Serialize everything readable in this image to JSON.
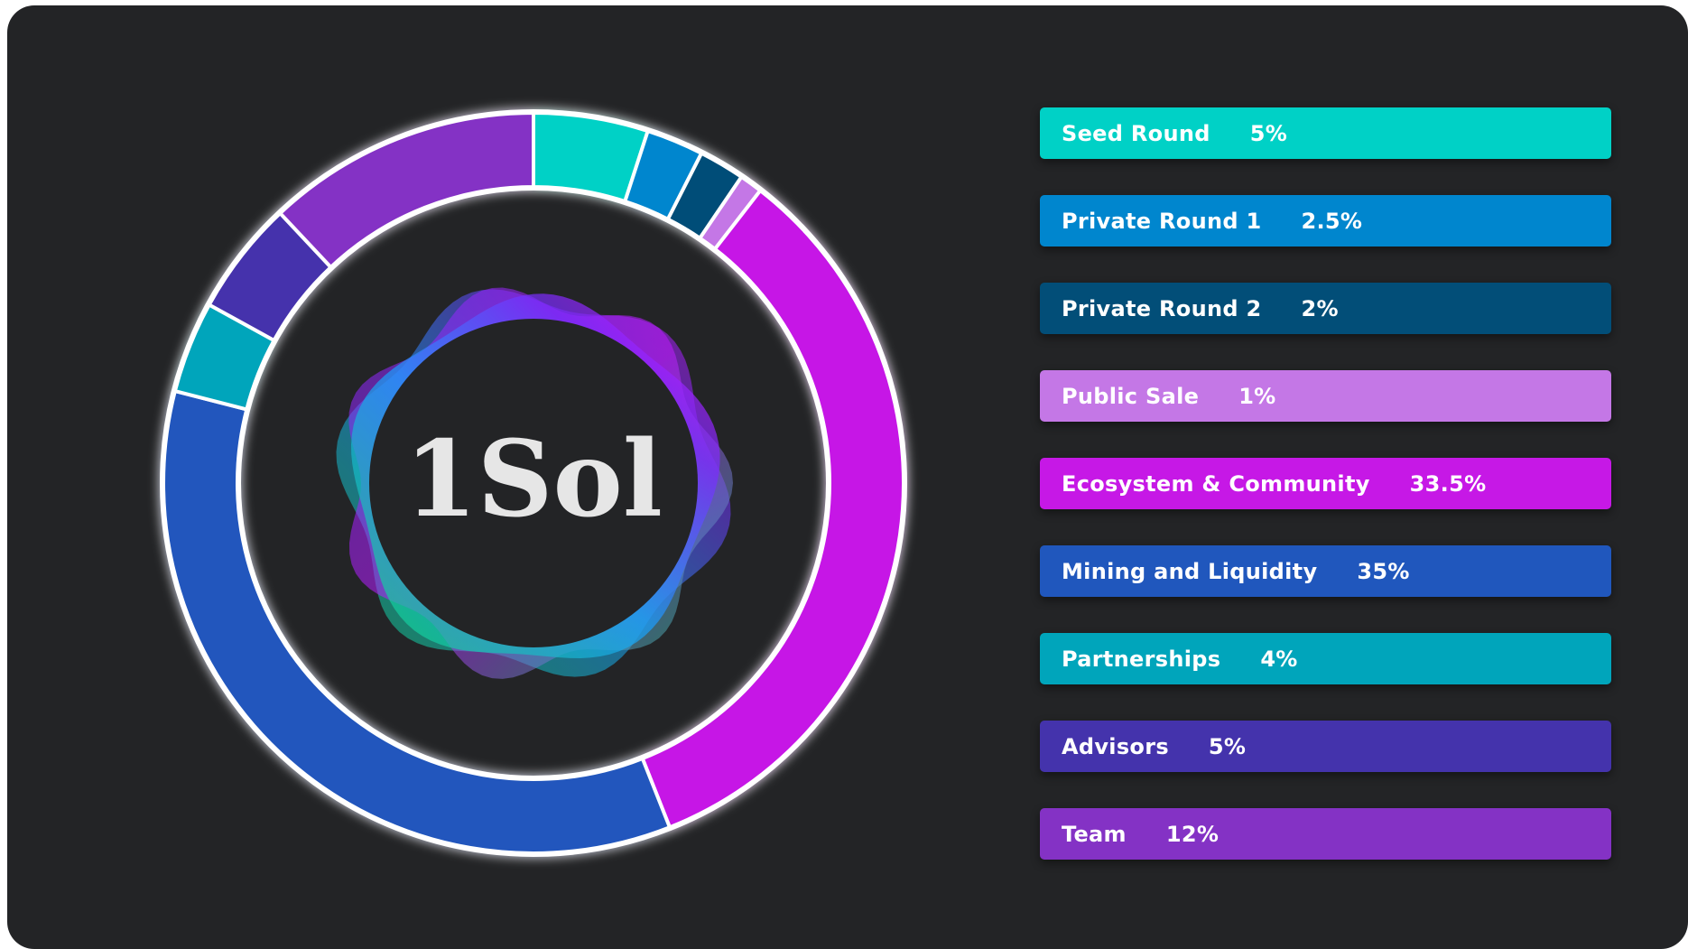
{
  "brand": {
    "logo_text": "1Sol",
    "logo_icon": "wavy-gradient-ring-icon"
  },
  "theme": {
    "card_background": "#232426",
    "ring_stroke": "#ffffff"
  },
  "chart_data": {
    "type": "pie",
    "style": "donut",
    "start_from": "top, clockwise",
    "categories": [
      "Seed Round",
      "Private Round 1",
      "Private Round 2",
      "Public Sale",
      "Ecosystem & Community",
      "Mining and Liquidity",
      "Partnerships",
      "Advisors",
      "Team"
    ],
    "values": [
      5,
      2.5,
      2,
      1,
      33.5,
      35,
      4,
      5,
      12
    ],
    "value_labels": [
      "5%",
      "2.5%",
      "2%",
      "1%",
      "33.5%",
      "35%",
      "4%",
      "5%",
      "12%"
    ],
    "colors": [
      "#00D1C6",
      "#0086CE",
      "#024E78",
      "#C477E6",
      "#C618E6",
      "#2057BD",
      "#00A5BB",
      "#4433AC",
      "#8432C5"
    ],
    "legend_position": "right"
  }
}
